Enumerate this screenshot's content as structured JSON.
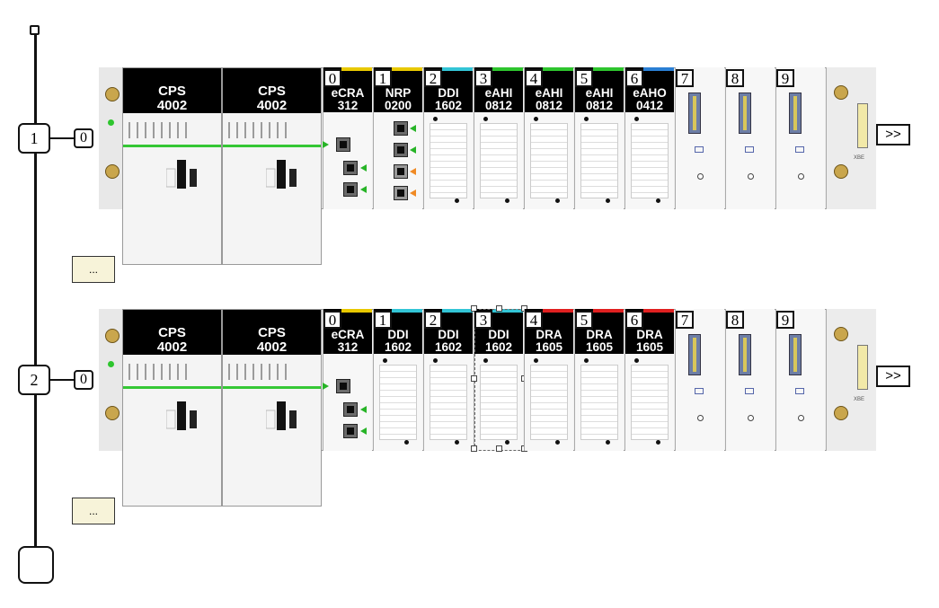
{
  "bus": {
    "drops": [
      {
        "label": "1",
        "rack_label": "0",
        "power_supplies": [
          "CPS\n4002",
          "CPS\n4002"
        ],
        "slots": [
          {
            "num": "0",
            "module": "eCRA\n312",
            "stripe": "#e8c800",
            "kind": "adapter"
          },
          {
            "num": "1",
            "module": "NRP\n0200",
            "stripe": "#e8c800",
            "kind": "nrp"
          },
          {
            "num": "2",
            "module": "DDI\n1602",
            "stripe": "#33c5d6",
            "kind": "io"
          },
          {
            "num": "3",
            "module": "eAHI\n0812",
            "stripe": "#2ec52e",
            "kind": "io"
          },
          {
            "num": "4",
            "module": "eAHI\n0812",
            "stripe": "#2ec52e",
            "kind": "io"
          },
          {
            "num": "5",
            "module": "eAHI\n0812",
            "stripe": "#2ec52e",
            "kind": "io"
          },
          {
            "num": "6",
            "module": "eAHO\n0412",
            "stripe": "#2a7fd4",
            "kind": "io"
          },
          {
            "num": "7",
            "module": "",
            "stripe": "",
            "kind": "empty"
          },
          {
            "num": "8",
            "module": "",
            "stripe": "",
            "kind": "empty"
          },
          {
            "num": "9",
            "module": "",
            "stripe": "",
            "kind": "empty"
          }
        ],
        "expand_label": ">>",
        "more_label": "..."
      },
      {
        "label": "2",
        "rack_label": "0",
        "power_supplies": [
          "CPS\n4002",
          "CPS\n4002"
        ],
        "slots": [
          {
            "num": "0",
            "module": "eCRA\n312",
            "stripe": "#e8c800",
            "kind": "adapter"
          },
          {
            "num": "1",
            "module": "DDI\n1602",
            "stripe": "#33c5d6",
            "kind": "io"
          },
          {
            "num": "2",
            "module": "DDI\n1602",
            "stripe": "#33c5d6",
            "kind": "io"
          },
          {
            "num": "3",
            "module": "DDI\n1602",
            "stripe": "#33c5d6",
            "kind": "io",
            "selected": true
          },
          {
            "num": "4",
            "module": "DRA\n1605",
            "stripe": "#e02020",
            "kind": "io"
          },
          {
            "num": "5",
            "module": "DRA\n1605",
            "stripe": "#e02020",
            "kind": "io"
          },
          {
            "num": "6",
            "module": "DRA\n1605",
            "stripe": "#e02020",
            "kind": "io"
          },
          {
            "num": "7",
            "module": "",
            "stripe": "",
            "kind": "empty"
          },
          {
            "num": "8",
            "module": "",
            "stripe": "",
            "kind": "empty"
          },
          {
            "num": "9",
            "module": "",
            "stripe": "",
            "kind": "empty"
          }
        ],
        "expand_label": ">>",
        "more_label": "..."
      }
    ],
    "end_label": "XBE"
  }
}
